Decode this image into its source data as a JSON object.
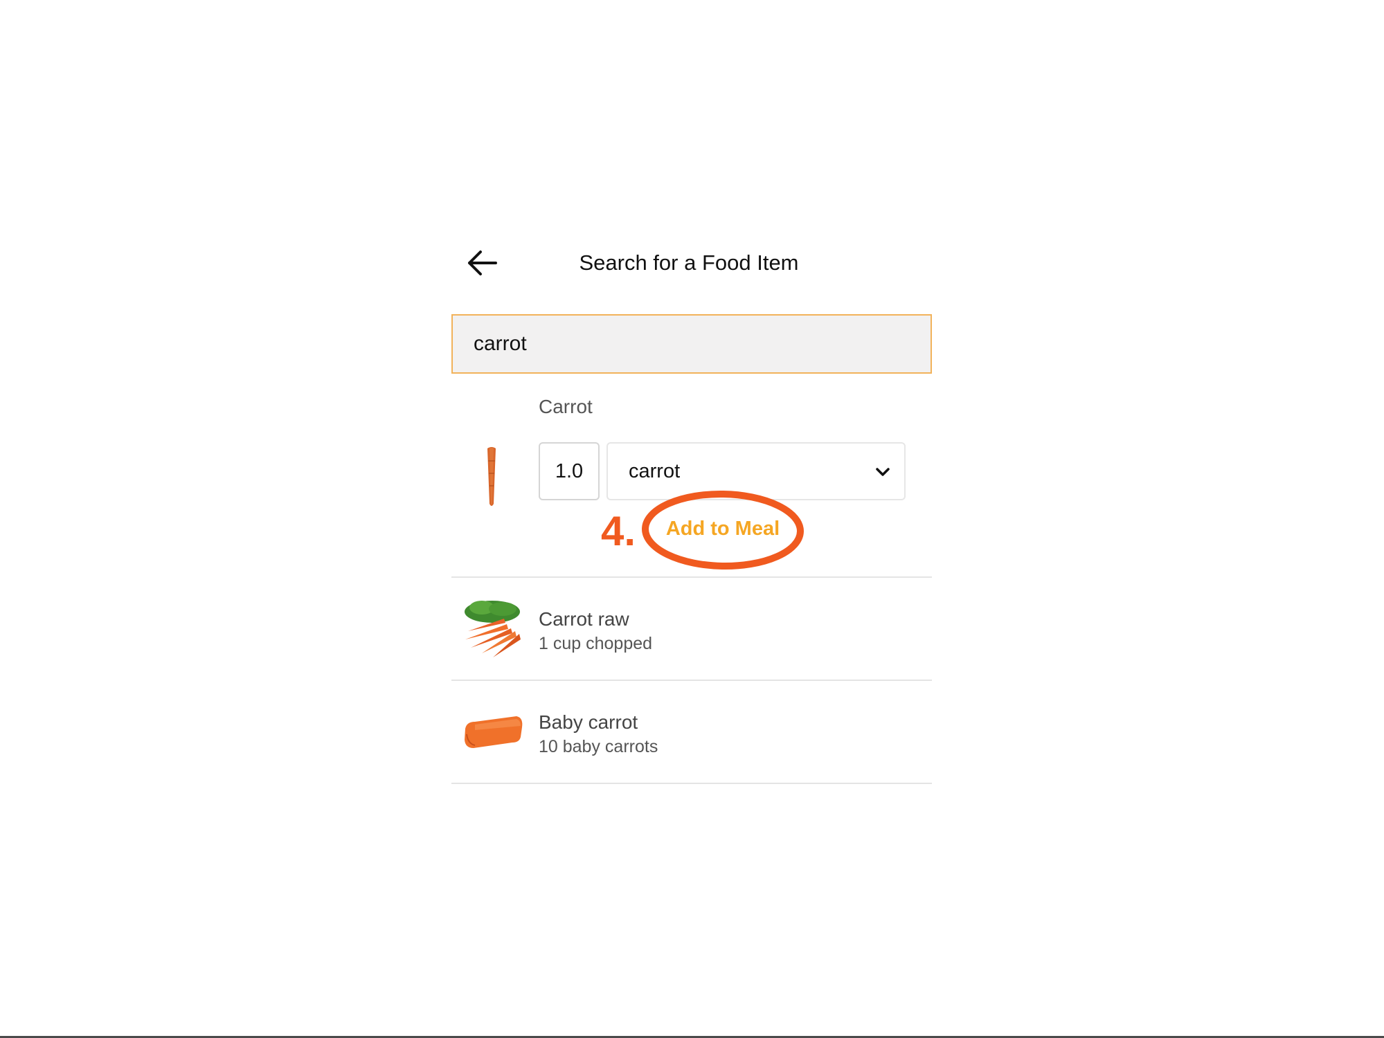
{
  "header": {
    "back_icon": "back-arrow-icon",
    "title": "Search for a Food Item"
  },
  "search": {
    "value": "carrot"
  },
  "selected_item": {
    "name": "Carrot",
    "image": "single-carrot-image",
    "quantity": "1.0",
    "unit": "carrot",
    "unit_dropdown_icon": "chevron-down-icon",
    "add_label": "Add to Meal"
  },
  "annotation": {
    "step": "4.",
    "color": "#f05a1f"
  },
  "results": [
    {
      "name": "Carrot raw",
      "serving": "1 cup chopped",
      "image": "carrot-bunch-image"
    },
    {
      "name": "Baby carrot",
      "serving": "10 baby carrots",
      "image": "baby-carrot-image"
    }
  ],
  "colors": {
    "accent": "#f5a623",
    "search_border": "#f2b25a",
    "search_bg": "#f2f1f1"
  }
}
